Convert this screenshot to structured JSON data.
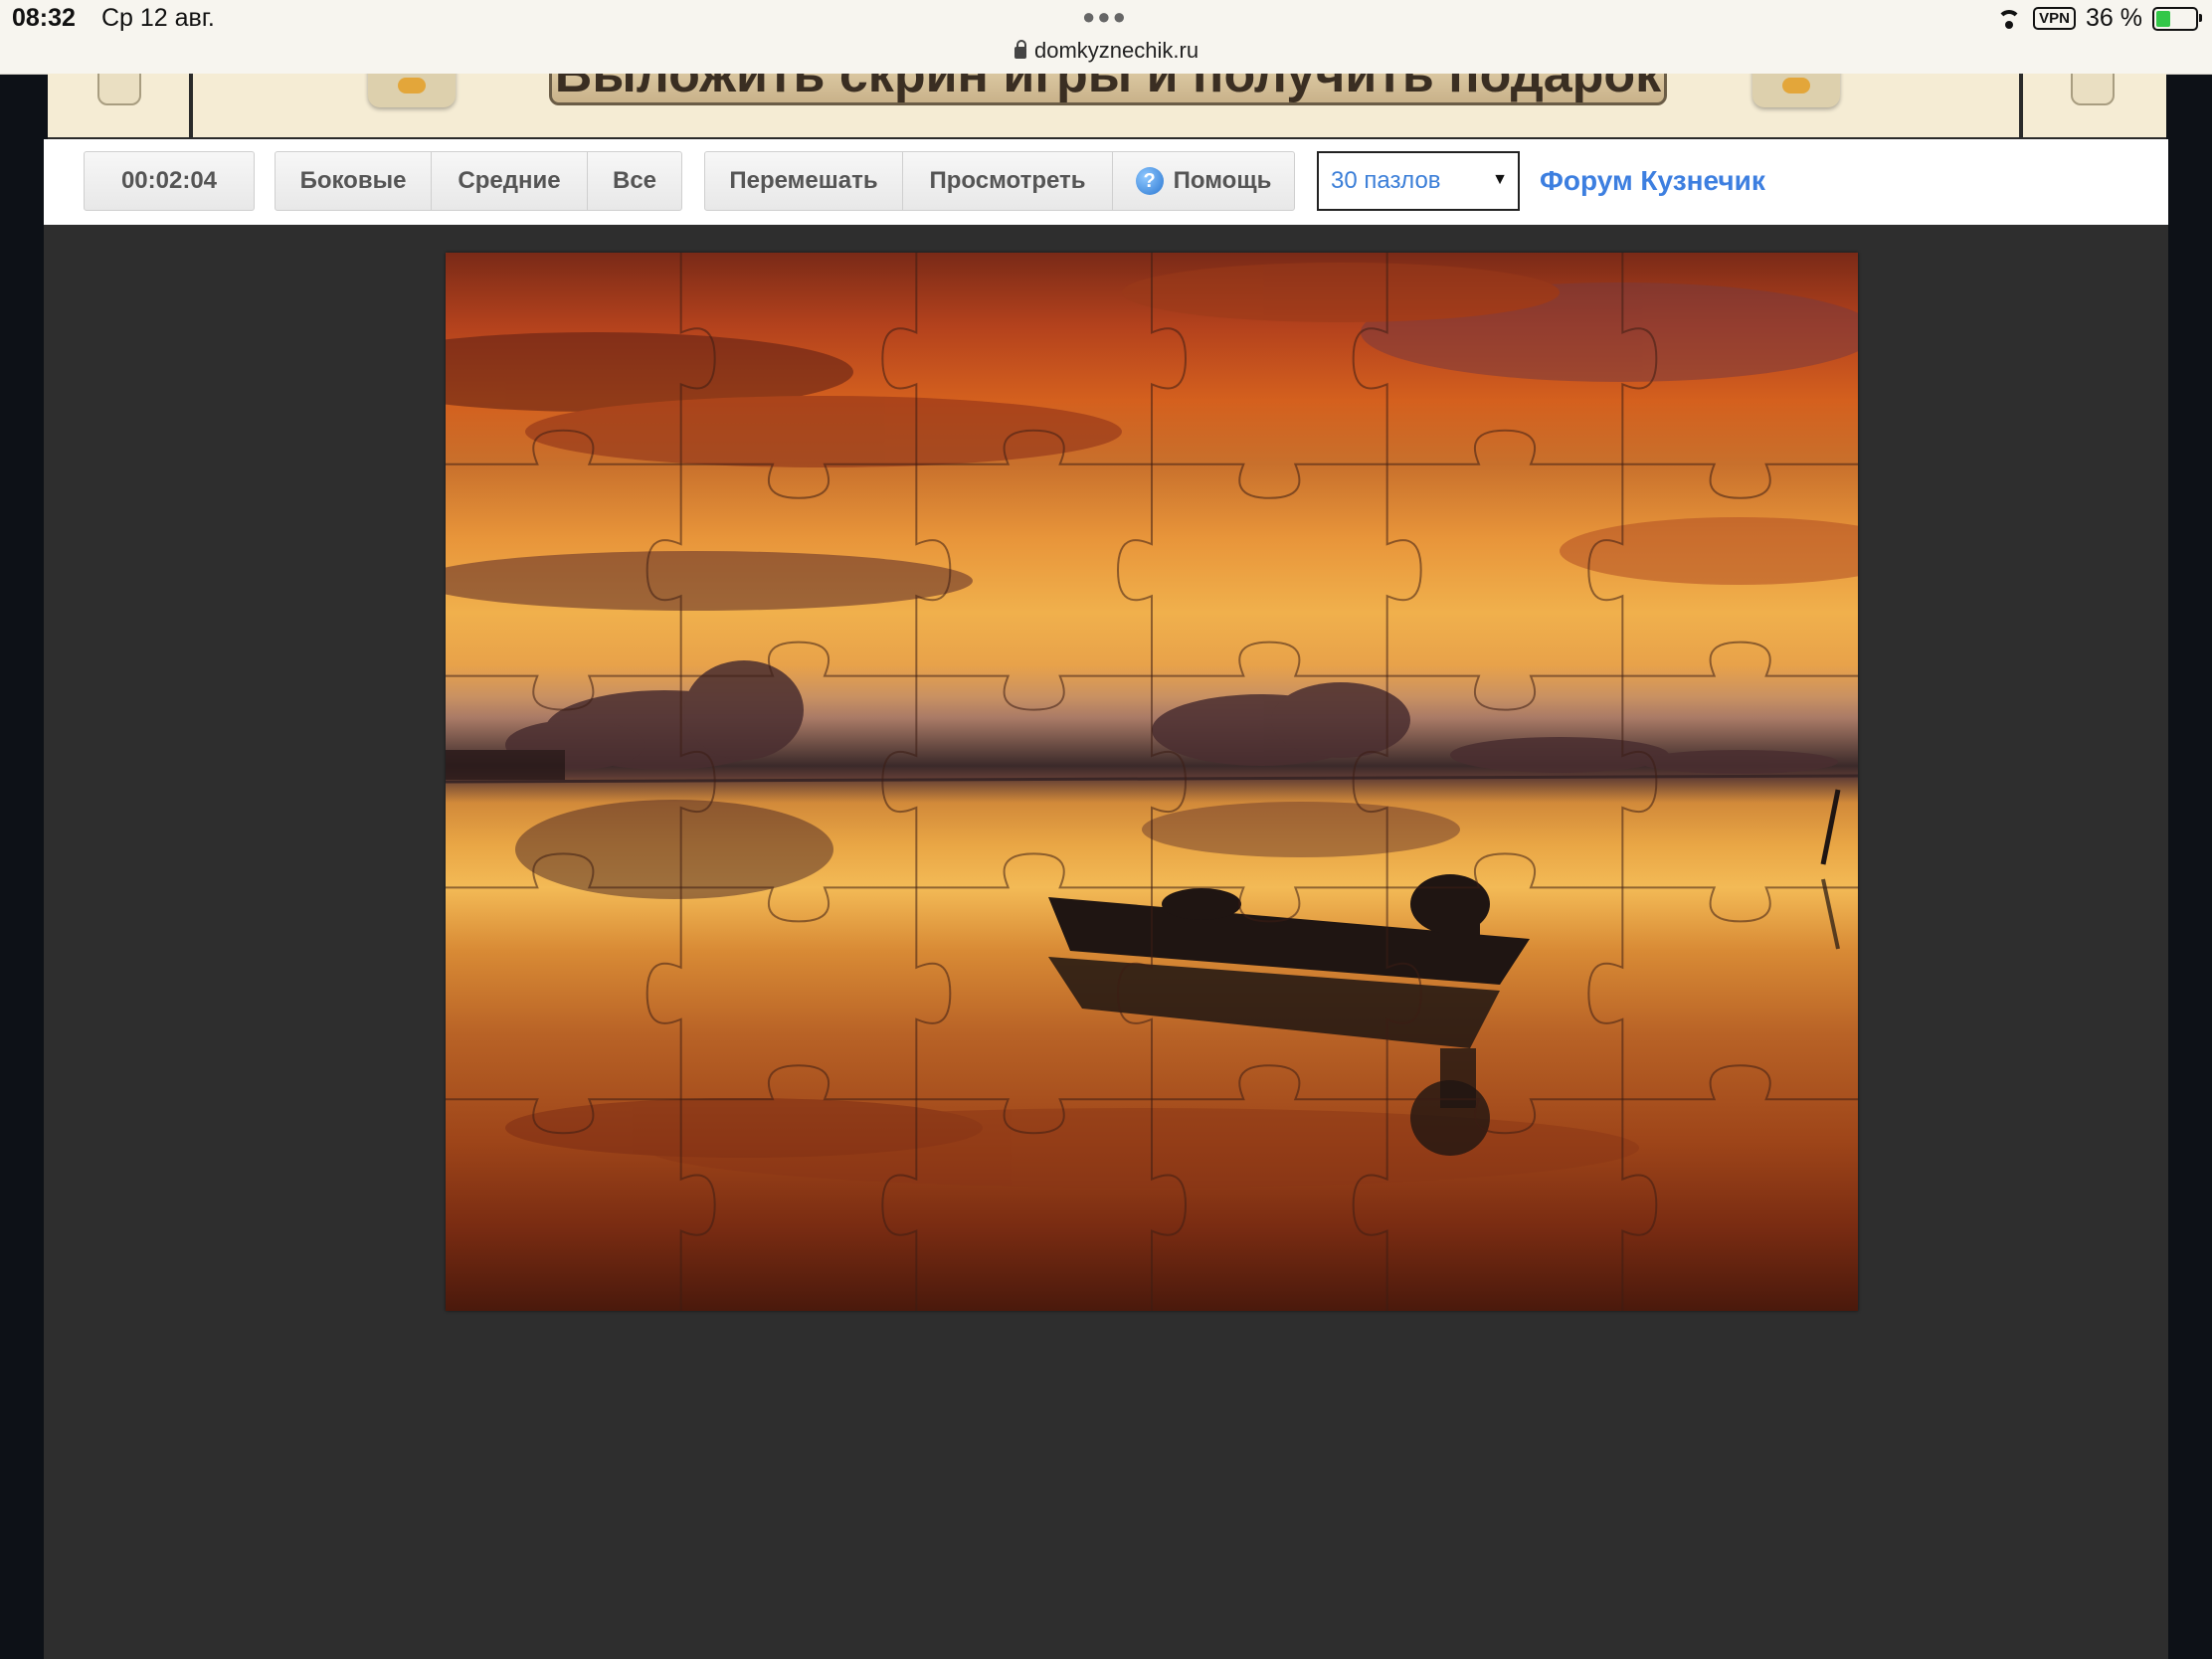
{
  "status_bar": {
    "time": "08:32",
    "date": "Ср 12 авг.",
    "url": "domkyznechik.ru",
    "vpn_label": "VPN",
    "battery_percent": "36 %",
    "battery_level": 0.36
  },
  "banner": {
    "button_text": "Выложить скрин игры и получить подарок"
  },
  "toolbar": {
    "timer": "00:02:04",
    "filter_buttons": [
      "Боковые",
      "Средние",
      "Все"
    ],
    "shuffle_label": "Перемешать",
    "preview_label": "Просмотреть",
    "help_label": "Помощь",
    "help_icon_glyph": "?",
    "pieces_select": "30 пазлов",
    "forum_link": "Форум Кузнечик"
  },
  "puzzle": {
    "columns": 6,
    "rows": 5,
    "image_subject": "sunset over calm water with a small boat"
  },
  "colors": {
    "link": "#3d7fe0",
    "stage_background": "#2e2e2e",
    "battery_green": "#33c748"
  }
}
